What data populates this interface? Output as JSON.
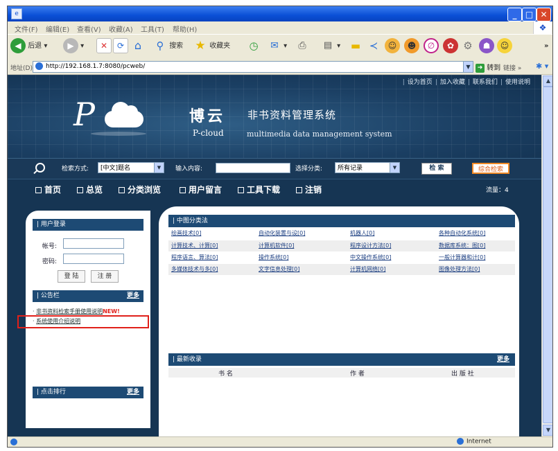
{
  "browser": {
    "menu": [
      "文件(F)",
      "编辑(E)",
      "查看(V)",
      "收藏(A)",
      "工具(T)",
      "帮助(H)"
    ],
    "toolbar": {
      "back": "后退",
      "search": "搜索",
      "favorites": "收藏夹"
    },
    "address_label": "地址(D)",
    "address_url": "http://192.168.1.7:8080/pcweb/",
    "go_label": "转到",
    "links_label": "链接",
    "status_zone": "Internet"
  },
  "site": {
    "top_links": [
      "设为首页",
      "加入收藏",
      "联系我们",
      "使用说明"
    ],
    "logo_letter": "P",
    "brand_cn": "博云",
    "system_cn": "非书资料管理系统",
    "brand_en": "P-cloud",
    "system_en": "multimedia data management system"
  },
  "search": {
    "method_label": "检索方式:",
    "method_value": "[中文]题名",
    "input_label": "输入内容:",
    "input_value": "",
    "category_label": "选择分类:",
    "category_value": "所有记录",
    "search_button": "检 索",
    "advanced_button": "综合检索"
  },
  "nav": {
    "items": [
      "首页",
      "总览",
      "分类浏览",
      "用户留言",
      "工具下载",
      "注销"
    ],
    "visits": "流量：4"
  },
  "left": {
    "login_title": "用户登录",
    "account_label": "帐号:",
    "password_label": "密码:",
    "login_button": "登 陆",
    "register_button": "注 册",
    "notice_title": "公告栏",
    "more": "更多",
    "notices": [
      {
        "text": "非书资料检索手册使用说明",
        "tag": "NEW!"
      },
      {
        "text": "系统使用介绍说明"
      }
    ],
    "rank_title": "点击排行"
  },
  "main": {
    "classification_title": "中图分类法",
    "categories": [
      [
        "绘画技术[0]",
        "自动化装置与设[0]",
        "机器人[0]",
        "各种自动化系统[0]"
      ],
      [
        "计算技术、计算[0]",
        "计算机软件[0]",
        "程序设计方法[0]",
        "数据库系统：图[0]"
      ],
      [
        "程序语言、算法[0]",
        "操作系统[0]",
        "中文操作系统[0]",
        "一般计算器和计[0]"
      ],
      [
        "多媒体技术与多[0]",
        "文字信息处理[0]",
        "计算机网络[0]",
        "图像处理方法[0]"
      ]
    ],
    "latest_title": "最新收录",
    "more": "更多",
    "columns": [
      "书 名",
      "作 者",
      "出 版 社"
    ]
  }
}
